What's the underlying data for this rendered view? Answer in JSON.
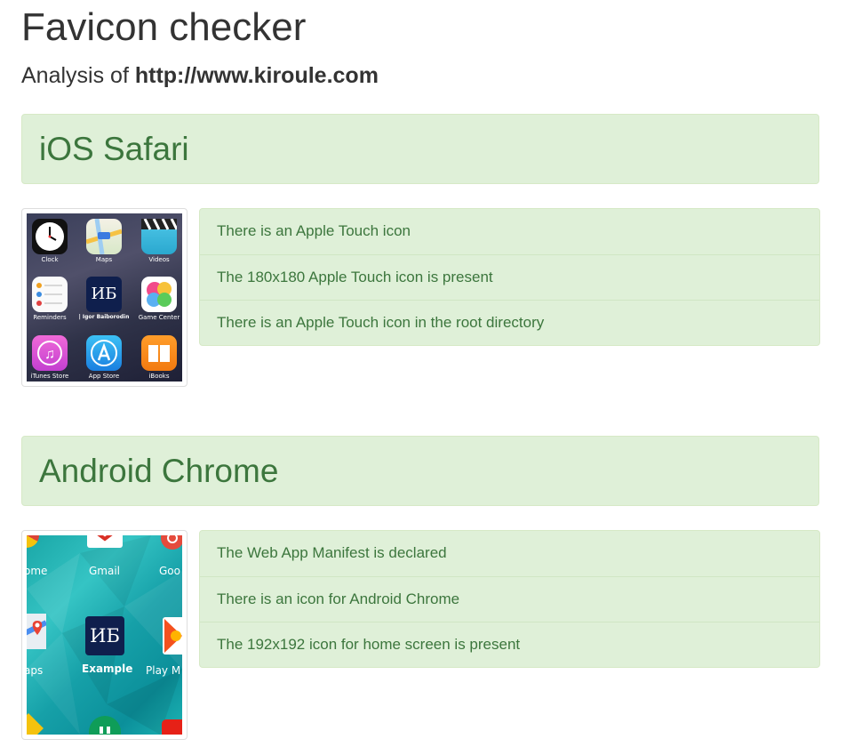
{
  "page": {
    "title": "Favicon checker",
    "analysis_prefix": "Analysis of ",
    "analysis_url": "http://www.kiroule.com"
  },
  "sections": [
    {
      "title": "iOS Safari",
      "checks": [
        "There is an Apple Touch icon",
        "The 180x180 Apple Touch icon is present",
        "There is an Apple Touch icon in the root directory"
      ],
      "preview": {
        "apps": [
          {
            "label": "Clock",
            "icon": "clock-icon"
          },
          {
            "label": "Maps",
            "icon": "maps-icon"
          },
          {
            "label": "Videos",
            "icon": "videos-icon"
          },
          {
            "label": "Reminders",
            "icon": "reminders-icon"
          },
          {
            "label": "| Igor Baiborodin",
            "icon": "site-favicon",
            "text": "ИБ"
          },
          {
            "label": "Game Center",
            "icon": "game-center-icon"
          },
          {
            "label": "iTunes Store",
            "icon": "itunes-icon"
          },
          {
            "label": "App Store",
            "icon": "app-store-icon"
          },
          {
            "label": "iBooks",
            "icon": "ibooks-icon"
          }
        ]
      }
    },
    {
      "title": "Android Chrome",
      "checks": [
        "The Web App Manifest is declared",
        "There is an icon for Android Chrome",
        "The 192x192 icon for home screen is present"
      ],
      "preview": {
        "labels": [
          "ome",
          "Gmail",
          "Goo",
          "aps",
          "Example",
          "Play M"
        ],
        "favicon_text": "ИБ"
      }
    }
  ],
  "colors": {
    "success_bg": "#dff0d8",
    "success_border": "#d6e9c6",
    "success_text": "#3c763d",
    "favicon_bg": "#0f1f4d"
  }
}
